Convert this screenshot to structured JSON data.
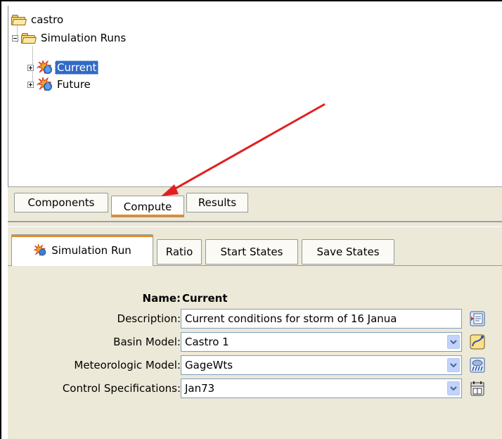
{
  "tree": {
    "root": "castro",
    "group": "Simulation Runs",
    "runs": [
      {
        "label": "Current",
        "selected": true
      },
      {
        "label": "Future",
        "selected": false
      }
    ]
  },
  "main_tabs": [
    "Components",
    "Compute",
    "Results"
  ],
  "main_tab_active": "Compute",
  "run_tabs": [
    "Simulation Run",
    "Ratio",
    "Start States",
    "Save States"
  ],
  "form": {
    "name_label": "Name:",
    "name_value": "Current",
    "description_label": "Description:",
    "description_value": "Current conditions for storm of 16 Janua",
    "basin_label": "Basin Model:",
    "basin_value": "Castro 1",
    "met_label": "Meteorologic Model:",
    "met_value": "GageWts",
    "control_label": "Control Specifications:",
    "control_value": "Jan73"
  },
  "icons": {
    "root": "folder-icon",
    "group": "folder-icon",
    "run": "simulation-run-icon",
    "description_button": "edit-description-icon",
    "basin_button": "basin-model-icon",
    "met_button": "meteorologic-model-icon",
    "control_button": "calendar-icon"
  },
  "colors": {
    "selection": "#316ac5",
    "active_tab_accent": "#e68b2c",
    "annotation_arrow": "#e02020",
    "panel_bg": "#ece9d8"
  }
}
